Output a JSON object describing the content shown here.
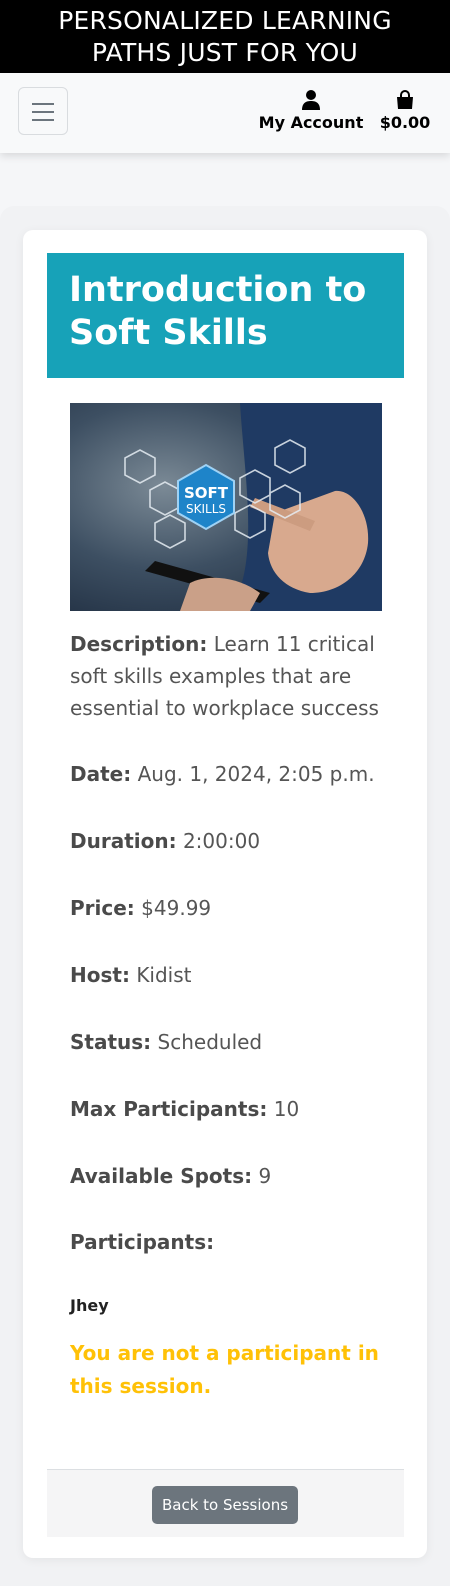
{
  "promo_banner": {
    "line1": "PERSONALIZED LEARNING",
    "line2": "PATHS JUST FOR YOU"
  },
  "navbar": {
    "menu_icon": "hamburger-menu-icon",
    "account_label": "My Account",
    "account_icon": "user-icon",
    "cart_total": "$0.00",
    "cart_icon": "shopping-bag-icon"
  },
  "session": {
    "title": "Introduction to Soft Skills",
    "image_text_line1": "SOFT",
    "image_text_line2": "SKILLS",
    "description_label": "Description:",
    "description_value": "Learn 11 critical soft skills examples that are essential to workplace success",
    "date_label": "Date:",
    "date_value": "Aug. 1, 2024, 2:05 p.m.",
    "duration_label": "Duration:",
    "duration_value": "2:00:00",
    "price_label": "Price:",
    "price_value": "$49.99",
    "host_label": "Host:",
    "host_value": "Kidist",
    "status_label": "Status:",
    "status_value": "Scheduled",
    "max_label": "Max Participants:",
    "max_value": "10",
    "spots_label": "Available Spots:",
    "spots_value": "9",
    "participants_label": "Participants:",
    "participants": [
      "Jhey"
    ],
    "not_participant_message": "You are not a participant in this session.",
    "back_button_label": "Back to Sessions"
  },
  "colors": {
    "header_bg": "#17a2b8",
    "warning_text": "#ffc107",
    "secondary_button": "#6c757d",
    "promo_bg": "#000000"
  }
}
